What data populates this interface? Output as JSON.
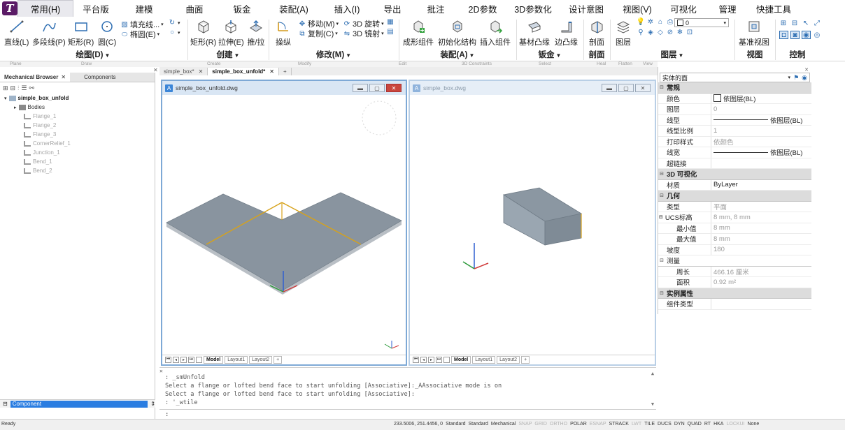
{
  "app": {
    "logo_letter": "T"
  },
  "menu": {
    "tabs": [
      "常用(H)",
      "平台版",
      "建模",
      "曲面",
      "钣金",
      "装配(A)",
      "插入(I)",
      "导出",
      "批注",
      "2D参数",
      "3D参数化",
      "设计意图",
      "视图(V)",
      "可视化",
      "管理",
      "快捷工具"
    ],
    "active_index": 0
  },
  "ribbon": {
    "draw": {
      "title": "绘图(D)",
      "line": "直线(L)",
      "polyline": "多段线(P)",
      "rect": "矩形(R)",
      "circle": "圆(C)",
      "hatch": "填充线...",
      "ellipse": "椭圆(E)"
    },
    "create": {
      "title": "创建",
      "box": "矩形(R)",
      "extrude": "拉伸(E)",
      "pushpull": "推/拉"
    },
    "modify": {
      "title": "修改(M)",
      "manipulate": "操纵",
      "move": "移动(M)",
      "copy": "复制(C)",
      "rotate3d": "3D 旋转",
      "mirror3d": "3D 镜射"
    },
    "assembly": {
      "title": "装配(A)",
      "form": "成形组件",
      "init": "初始化结构",
      "insert": "插入组件"
    },
    "sheetmetal": {
      "title": "钣金",
      "base": "基材凸缘",
      "edge": "边凸缘"
    },
    "section": {
      "title": "剖面",
      "btn": "剖面"
    },
    "layers": {
      "title": "图层",
      "btn": "图层",
      "current": "0"
    },
    "view": {
      "title": "视图",
      "btn": "基准视图"
    },
    "control": {
      "title": "控制"
    }
  },
  "substrip": [
    "Plane",
    "Draw",
    "Create",
    "Modify",
    "Edit",
    "3D Constraints",
    "Select",
    "Heal",
    "Flatten",
    "View"
  ],
  "left_panel": {
    "tabs": [
      "Mechanical Browser",
      "Components"
    ],
    "tree": {
      "root": "simple_box_unfold",
      "bodies": "Bodies",
      "features": [
        "Flange_1",
        "Flange_2",
        "Flange_3",
        "CornerRelief_1",
        "Junction_1",
        "Bend_1",
        "Bend_2"
      ]
    },
    "footer": "Component"
  },
  "doc_tabs": [
    "simple_box*",
    "simple_box_unfold*"
  ],
  "viewport1": {
    "title": "simple_box_unfold.dwg",
    "layouts": [
      "Model",
      "Layout1",
      "Layout2"
    ]
  },
  "viewport2": {
    "title": "simple_box.dwg",
    "layouts": [
      "Model",
      "Layout1",
      "Layout2"
    ]
  },
  "properties": {
    "selection": "实体的面",
    "sections": {
      "general": "常规",
      "visual3d": "3D 可视化",
      "geometry": "几何",
      "measure": "测量",
      "instance": "实例属性"
    },
    "general": [
      {
        "name": "颜色",
        "value": "依图层(BL)"
      },
      {
        "name": "图层",
        "value": "0"
      },
      {
        "name": "线型",
        "value": "依图层(BL)"
      },
      {
        "name": "线型比例",
        "value": "1"
      },
      {
        "name": "打印样式",
        "value": "依颜色"
      },
      {
        "name": "线宽",
        "value": "依图层(BL)"
      },
      {
        "name": "超链接",
        "value": ""
      }
    ],
    "visual3d": [
      {
        "name": "材质",
        "value": "ByLayer"
      }
    ],
    "geometry": [
      {
        "name": "类型",
        "value": "平面"
      },
      {
        "name": "UCS标高",
        "value": "8 mm, 8 mm"
      },
      {
        "name": "最小值",
        "value": "8 mm"
      },
      {
        "name": "最大值",
        "value": "8 mm"
      },
      {
        "name": "坡度",
        "value": "180"
      }
    ],
    "measure": [
      {
        "name": "周长",
        "value": "466.16 厘米"
      },
      {
        "name": "面积",
        "value": "0.92 m²"
      }
    ],
    "instance": [
      {
        "name": "组件类型",
        "value": ""
      }
    ]
  },
  "command": {
    "lines": [
      ": _smUnfold",
      "Select a flange or lofted bend face to start unfolding [Associative]:_AAssociative mode is on",
      "Select a flange or lofted bend face to start unfolding [Associative]:",
      ": '_wtile"
    ],
    "prompt": ":"
  },
  "status": {
    "left": "Ready",
    "coords": "233.5006, 251.4456, 0",
    "items": [
      {
        "t": "Standard",
        "on": true
      },
      {
        "t": "Standard",
        "on": true
      },
      {
        "t": "Mechanical",
        "on": true
      },
      {
        "t": "SNAP",
        "on": false
      },
      {
        "t": "GRID",
        "on": false
      },
      {
        "t": "ORTHO",
        "on": false
      },
      {
        "t": "POLAR",
        "on": true
      },
      {
        "t": "ESNAP",
        "on": false
      },
      {
        "t": "STRACK",
        "on": true
      },
      {
        "t": "LWT",
        "on": false
      },
      {
        "t": "TILE",
        "on": true
      },
      {
        "t": "DUCS",
        "on": true
      },
      {
        "t": "DYN",
        "on": true
      },
      {
        "t": "QUAD",
        "on": true
      },
      {
        "t": "RT",
        "on": true
      },
      {
        "t": "HKA",
        "on": true
      },
      {
        "t": "LOCKUI",
        "on": false
      },
      {
        "t": "None",
        "on": true
      }
    ]
  },
  "colors": {
    "accent": "#2a7de1",
    "face": "#95a1ab",
    "bend_line": "#d7a21a",
    "logo": "#5b1b66"
  }
}
